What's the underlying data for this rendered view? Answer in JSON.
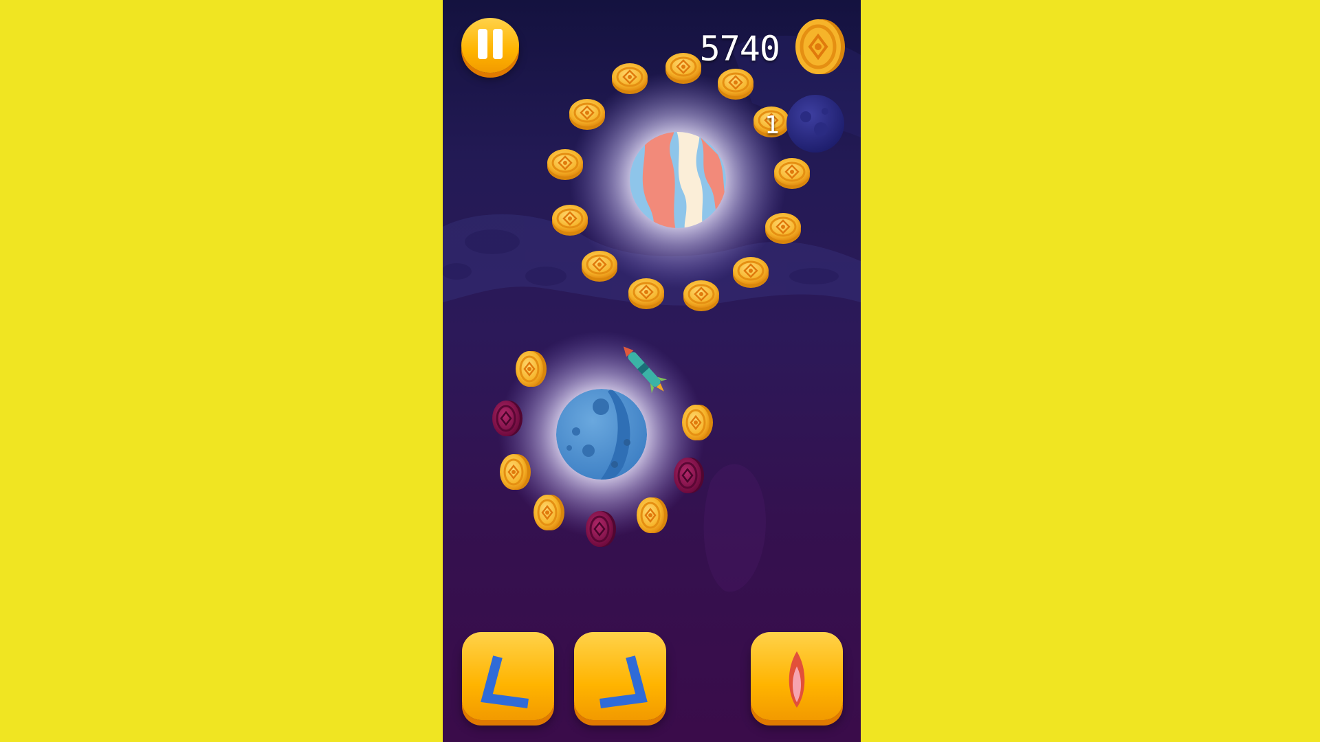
{
  "hud": {
    "score": "5740",
    "lives": "1",
    "icons": {
      "pause": "pause-icon",
      "coin": "coin-icon",
      "lives": "planet-lives-icon"
    }
  },
  "controls": {
    "left": "rotate-left-icon",
    "right": "rotate-right-icon",
    "boost": "rocket-flame-icon"
  },
  "colors": {
    "page_background": "#F0E522",
    "button_orange": "#FFB400",
    "arrow_blue": "#2F6BD8",
    "coin_gold": "#F6B42A",
    "bad_coin_magenta": "#8A0C4A"
  }
}
